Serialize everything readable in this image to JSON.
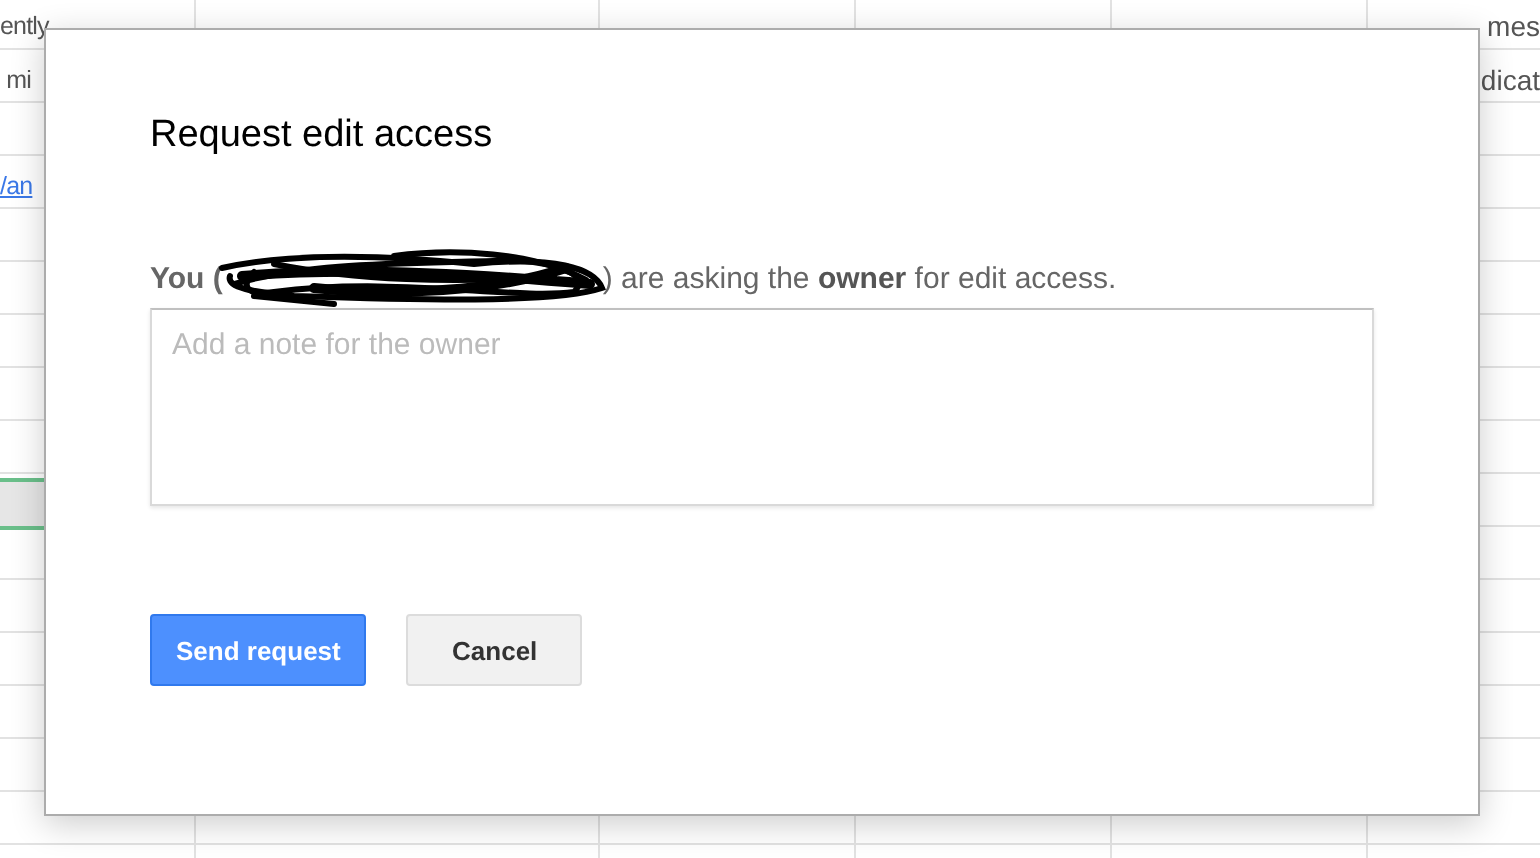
{
  "sheet": {
    "rows": [
      {
        "left": {
          "text": "ently",
          "kind": "text"
        },
        "right": {
          "text": "mes",
          "kind": "text"
        },
        "selected": false
      },
      {
        "left": {
          "text": " mi",
          "kind": "text"
        },
        "right": {
          "text": "dicat",
          "kind": "text"
        },
        "selected": false
      },
      {
        "selected": false
      },
      {
        "left": {
          "text": "/an",
          "kind": "link"
        },
        "selected": false
      },
      {
        "selected": false
      },
      {
        "selected": false
      },
      {
        "selected": false
      },
      {
        "selected": false
      },
      {
        "selected": false
      },
      {
        "selected": true
      },
      {
        "selected": false
      },
      {
        "selected": false
      },
      {
        "selected": false
      },
      {
        "selected": false
      },
      {
        "selected": false
      },
      {
        "selected": false
      },
      {
        "selected": false
      }
    ]
  },
  "dialog": {
    "title": "Request edit access",
    "message_start": "You (",
    "message_end": ") are asking the **owner** for edit access.",
    "note": {
      "placeholder": "Add a note for the owner"
    },
    "buttons": [
      {
        "label": "Send request",
        "kind": "primary"
      },
      {
        "label": "Cancel",
        "kind": "secondary"
      }
    ]
  }
}
